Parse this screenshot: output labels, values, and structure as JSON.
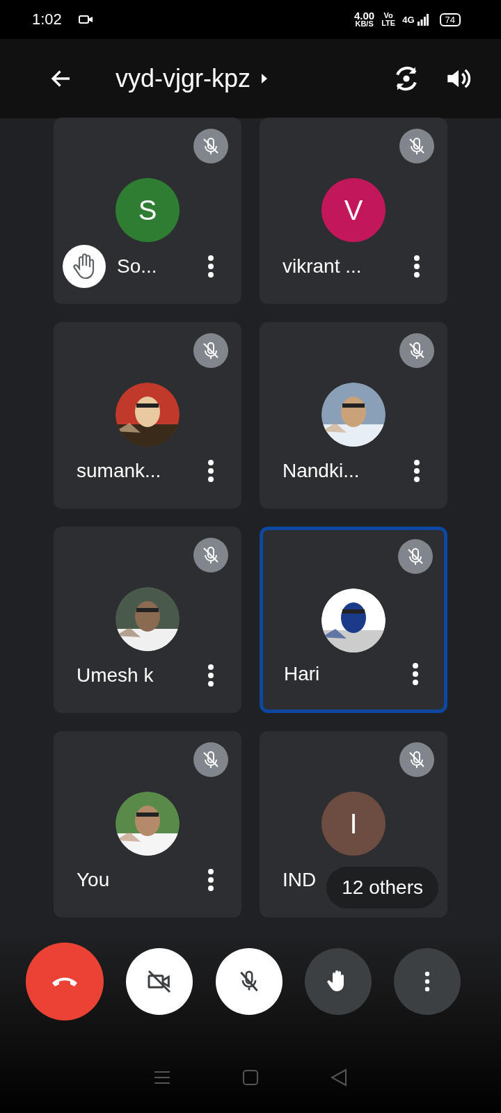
{
  "status_bar": {
    "time": "1:02",
    "speed": "4.00",
    "speed_unit": "KB/S",
    "volte_top": "Vo",
    "volte_bottom": "LTE",
    "network": "4G",
    "battery": "74"
  },
  "header": {
    "title": "vyd-vjgr-kpz"
  },
  "tiles": [
    {
      "name": "So...",
      "avatar": {
        "kind": "letter",
        "letter": "S",
        "color": "#2e7d32"
      },
      "muted": true,
      "hand_raised": true,
      "active": false
    },
    {
      "name": "vikrant ...",
      "avatar": {
        "kind": "letter",
        "letter": "V",
        "color": "#c2185b"
      },
      "muted": true,
      "hand_raised": false,
      "active": false
    },
    {
      "name": "sumank...",
      "muted": true,
      "hand_raised": false,
      "active": false
    },
    {
      "name": "Nandki...",
      "muted": true,
      "hand_raised": false,
      "active": false
    },
    {
      "name": "Umesh k",
      "muted": true,
      "hand_raised": false,
      "active": false
    },
    {
      "name": "Hari",
      "muted": true,
      "hand_raised": false,
      "active": true
    },
    {
      "name": "You",
      "muted": true,
      "hand_raised": false,
      "active": false
    },
    {
      "name": "IND",
      "avatar": {
        "kind": "letter",
        "letter": "I",
        "color": "#6d4c41"
      },
      "muted": true,
      "hand_raised": false,
      "active": false,
      "overlay": "12 others"
    }
  ],
  "controls": {
    "camera_on": false,
    "mic_on": false
  }
}
